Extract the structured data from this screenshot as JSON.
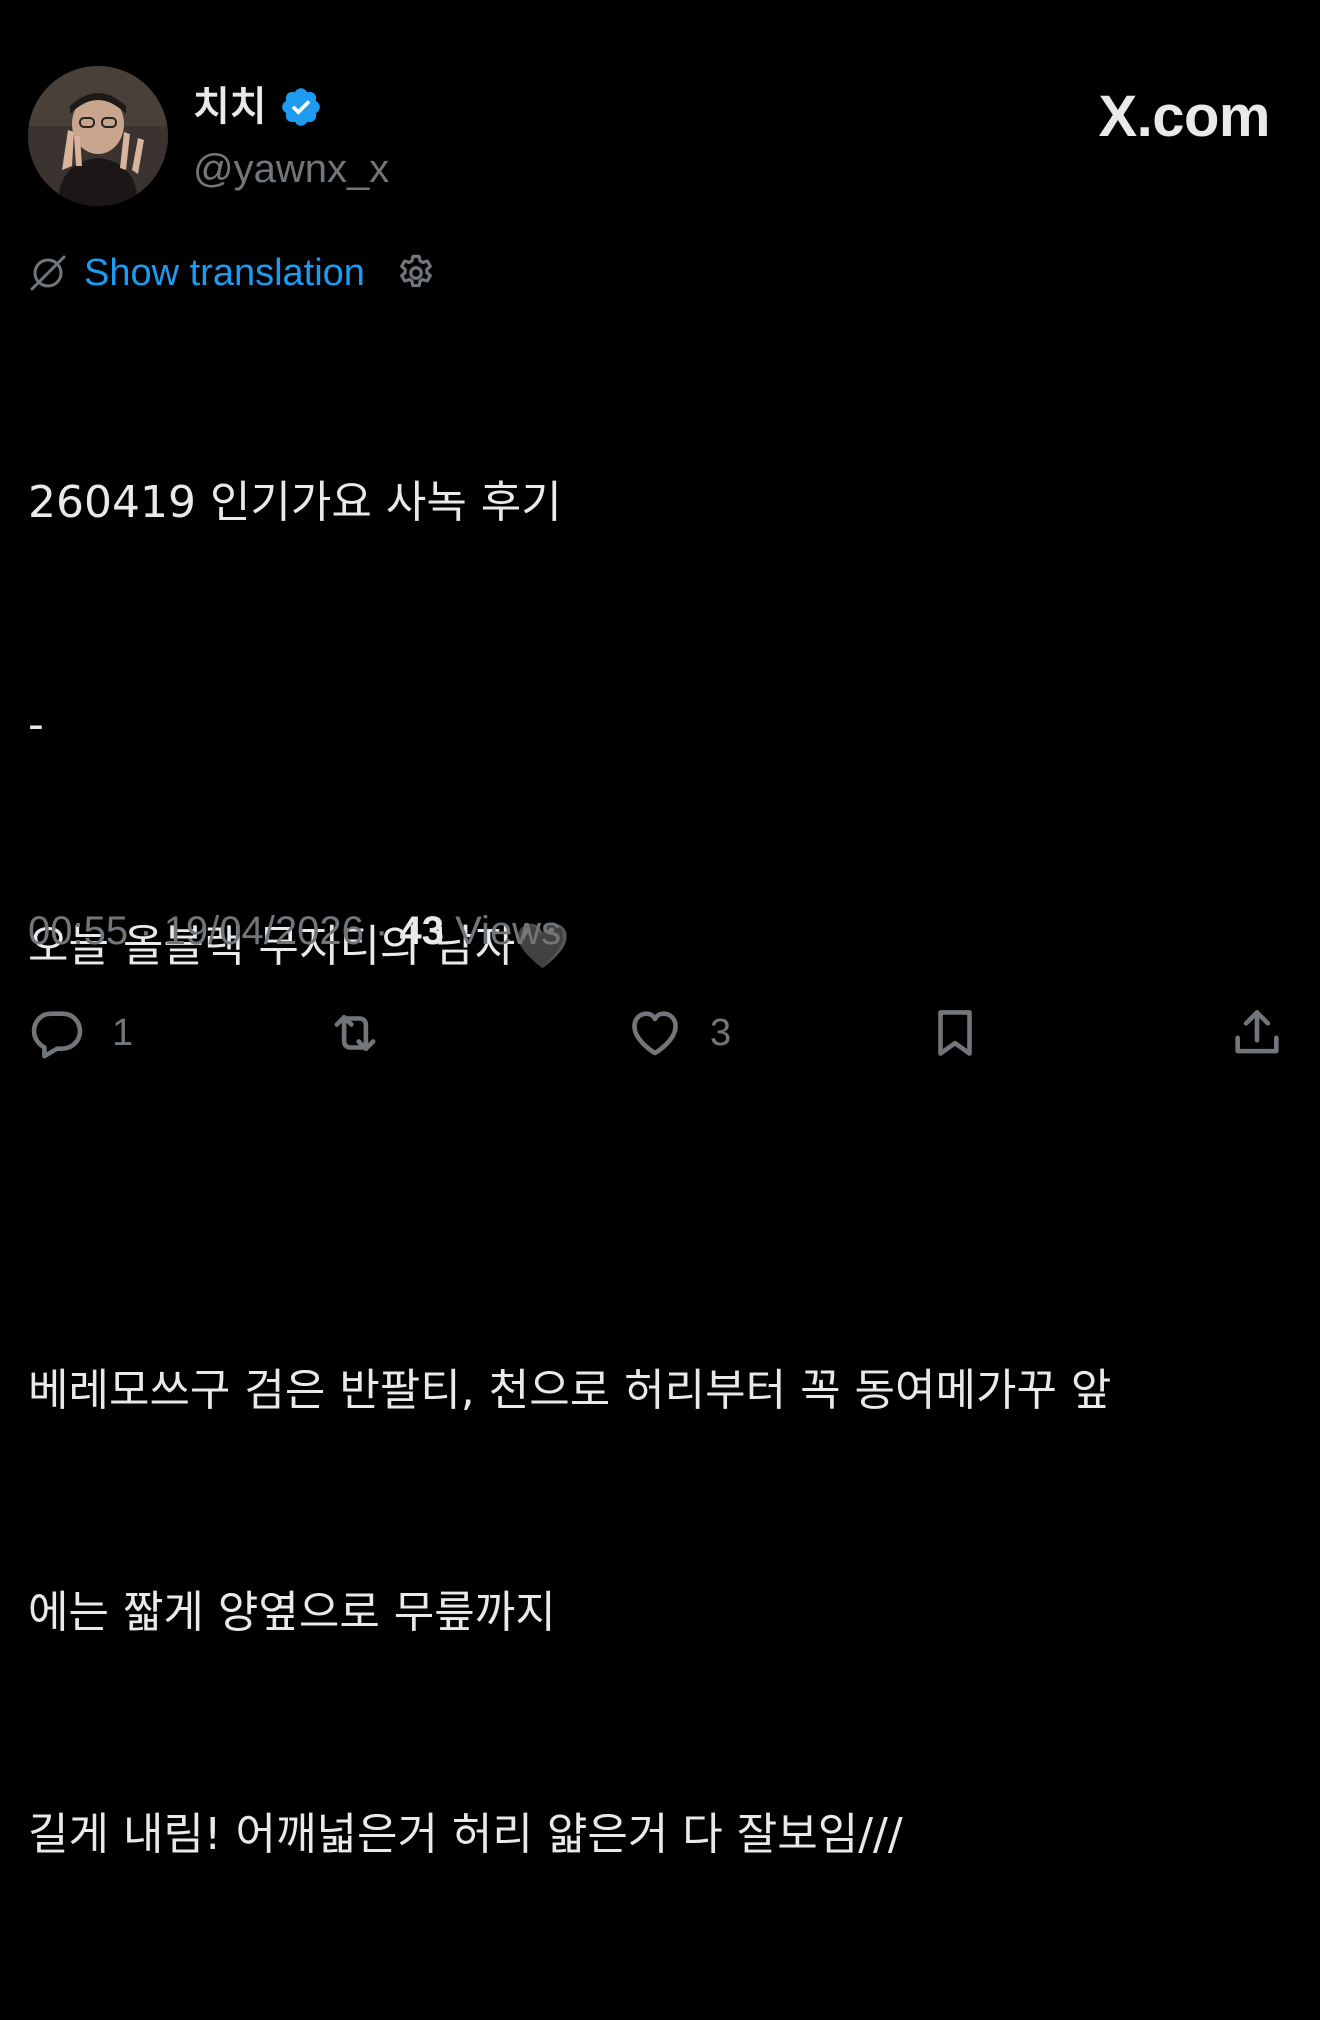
{
  "author": {
    "display_name": "치치",
    "handle": "@yawnx_x",
    "verified": true
  },
  "brand": "X.com",
  "translation": {
    "label": "Show translation"
  },
  "tweet": {
    "lines": [
      "260419 인기가요 사녹 후기",
      "-",
      "오늘 올블랙 무지티의 남자🖤",
      "",
      "베레모쓰구 검은 반팔티, 천으로 허리부터 꼭 동여메가꾸 앞",
      "에는 짧게 양옆으로 무릎까지",
      "길게 내림! 어깨넓은거 허리 얇은거 다 잘보임///"
    ]
  },
  "meta": {
    "time": "00:55",
    "date": "19/04/2026",
    "views_count": "43",
    "views_label": "Views",
    "separator": "·"
  },
  "actions": {
    "reply_count": "1",
    "like_count": "3"
  },
  "colors": {
    "background": "#000000",
    "text_primary": "#e7e9ea",
    "text_secondary": "#71767b",
    "accent": "#1d9bf0"
  }
}
